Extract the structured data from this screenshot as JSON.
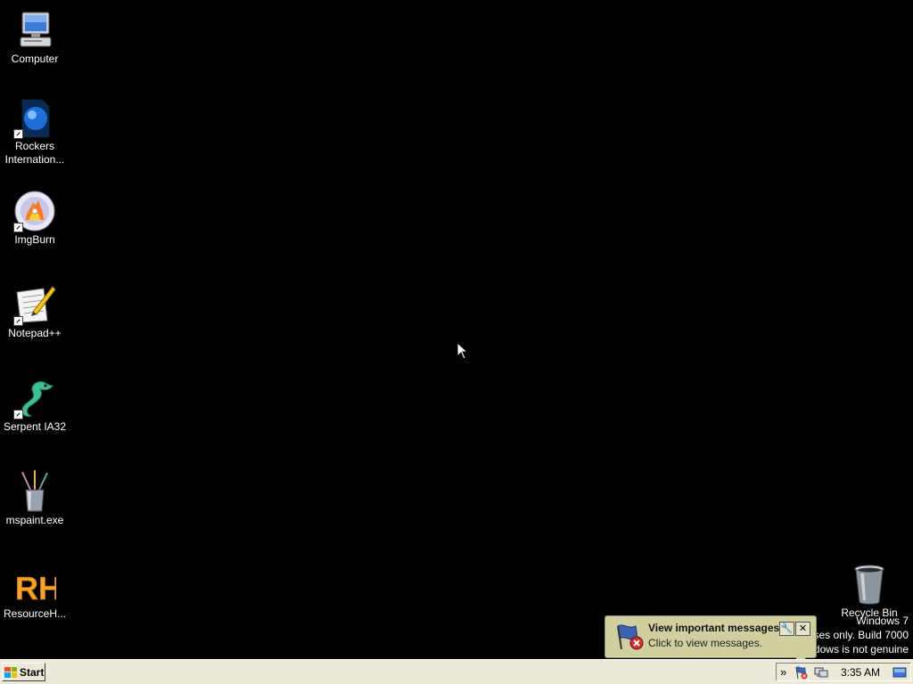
{
  "desktop": {
    "icons": [
      {
        "label": "Computer",
        "icon": "computer-icon"
      },
      {
        "label": "Rockers Internation...",
        "icon": "rockers-internation-icon"
      },
      {
        "label": "ImgBurn",
        "icon": "imgburn-disc-icon"
      },
      {
        "label": "Notepad++",
        "icon": "notepad-plus-plus-icon"
      },
      {
        "label": "Serpent IA32",
        "icon": "serpent-dragon-icon"
      },
      {
        "label": "mspaint.exe",
        "icon": "mspaint-brushes-icon"
      },
      {
        "label": "ResourceH...",
        "icon": "resource-hacker-icon"
      }
    ],
    "recycle_bin": {
      "label": "Recycle Bin",
      "icon": "recycle-bin-icon"
    }
  },
  "watermark": {
    "line1": "Windows 7",
    "line2": "For testing purposes only. Build 7000",
    "line3": "This copy of Windows is not genuine"
  },
  "balloon": {
    "title": "View important messages",
    "body": "Click to view messages.",
    "settings_glyph": "🔧",
    "close_glyph": "✕"
  },
  "taskbar": {
    "start_label": "Start",
    "tray_expand_glyph": "»",
    "clock": "3:35 AM"
  },
  "colors": {
    "desktop_bg": "#000000",
    "taskbar_bg": "#ece9d8",
    "balloon_bg": "#cfcfa0"
  }
}
